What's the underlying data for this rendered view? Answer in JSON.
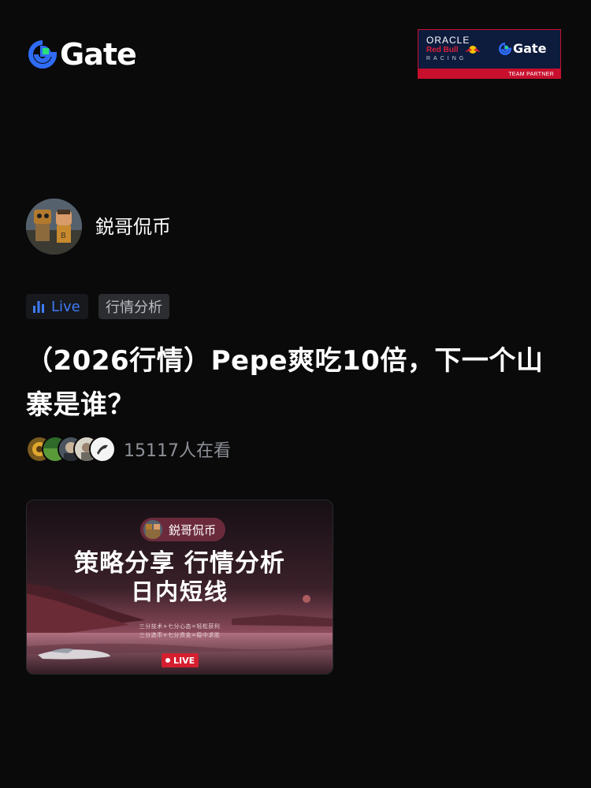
{
  "header": {
    "brand": "Gate",
    "partner": {
      "oracle": "ORACLE",
      "redbull": "Red Bull",
      "racing": "RACING",
      "gate": "Gate",
      "team_partner": "TEAM PARTNER"
    }
  },
  "author": {
    "name": "鋭哥侃币"
  },
  "tags": {
    "live": "Live",
    "category": "行情分析"
  },
  "title": "（2026行情）Pepe爽吃10倍，下一个山寨是谁？",
  "viewers": {
    "count_text": "15117人在看"
  },
  "cover": {
    "host_name": "鋭哥侃币",
    "headline_1": "策略分享 行情分析",
    "headline_2": "日内短线",
    "subline_1": "三分技术+七分心态=轻松获利",
    "subline_2": "三分选币+七分资金=稳中求胜",
    "live_badge": "LIVE"
  },
  "colors": {
    "accent_blue": "#3f7cf6",
    "live_red": "#d51f2f",
    "brand_green": "#27e07a"
  }
}
